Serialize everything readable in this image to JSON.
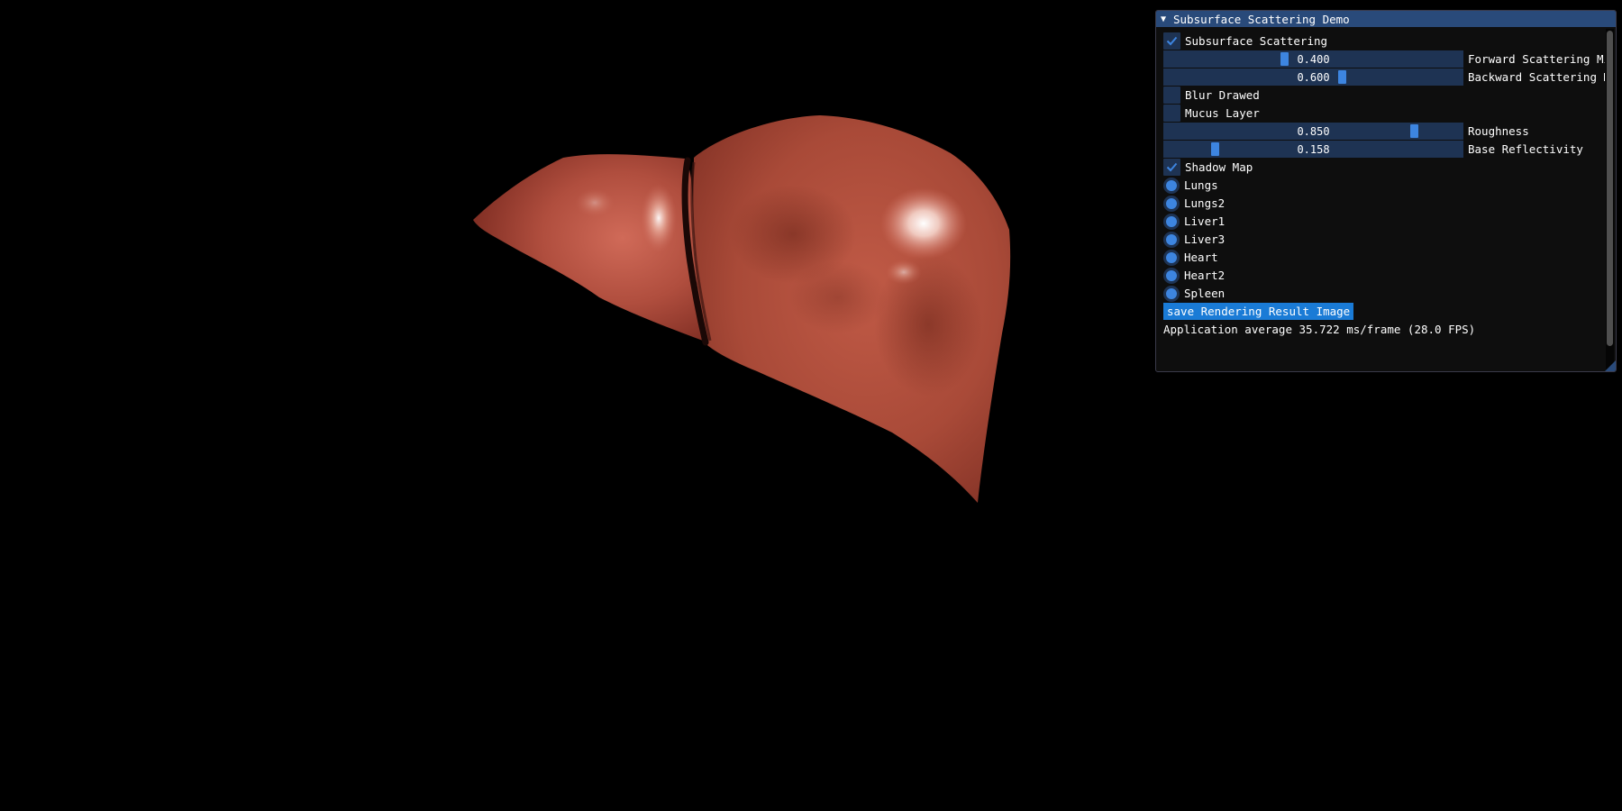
{
  "window": {
    "title": "Subsurface Scattering Demo",
    "collapse_icon": "triangle-down-icon"
  },
  "controls": {
    "subsurface_scattering": {
      "label": "Subsurface Scattering",
      "checked": true
    },
    "forward_scattering": {
      "label": "Forward Scattering Mi:",
      "value": "0.400",
      "fraction": 0.4
    },
    "backward_scattering": {
      "label": "Backward Scattering M·",
      "value": "0.600",
      "fraction": 0.6
    },
    "blur_drawed": {
      "label": "Blur Drawed",
      "checked": false
    },
    "mucus_layer": {
      "label": "Mucus Layer",
      "checked": false
    },
    "roughness": {
      "label": "Roughness",
      "value": "0.850",
      "fraction": 0.85
    },
    "base_reflectivity": {
      "label": "Base Reflectivity",
      "value": "0.158",
      "fraction": 0.158
    },
    "shadow_map": {
      "label": "Shadow Map",
      "checked": true
    },
    "models": [
      {
        "label": "Lungs"
      },
      {
        "label": "Lungs2"
      },
      {
        "label": "Liver1"
      },
      {
        "label": "Liver3"
      },
      {
        "label": "Heart"
      },
      {
        "label": "Heart2"
      },
      {
        "label": "Spleen"
      }
    ],
    "save_button": "save Rendering Result Image",
    "fps_text": "Application average 35.722 ms/frame (28.0 FPS)"
  },
  "colors": {
    "background": "#000000",
    "panel_bg": "#0f0f0f",
    "title_bg": "#294a7a",
    "frame_bg": "#1e3353",
    "accent": "#3d85e0",
    "button": "#1a7bd6",
    "liver_base": "#b04a38"
  }
}
